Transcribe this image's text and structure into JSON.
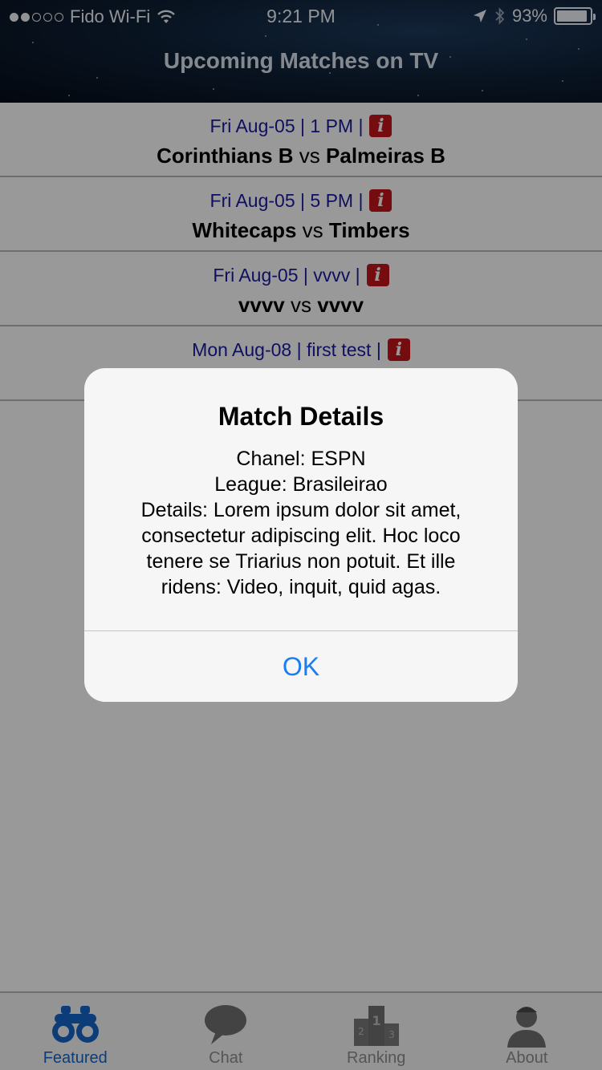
{
  "status_bar": {
    "carrier": "Fido Wi-Fi",
    "time": "9:21 PM",
    "battery": "93%",
    "battery_level": 0.93,
    "signal_bars_filled": 2,
    "signal_bars_total": 5,
    "icons": [
      "wifi-icon",
      "location-arrow-icon",
      "bluetooth-icon",
      "battery-icon"
    ]
  },
  "header": {
    "title": "Upcoming Matches on TV"
  },
  "matches": [
    {
      "meta": "Fri Aug-05 | 1 PM |",
      "home": "Corinthians B",
      "vs": "vs",
      "away": "Palmeiras B"
    },
    {
      "meta": "Fri Aug-05 | 5 PM |",
      "home": "Whitecaps",
      "vs": "vs",
      "away": "Timbers"
    },
    {
      "meta": "Fri Aug-05 | vvvv |",
      "home": "vvvv",
      "vs": "vs",
      "away": "vvvv"
    },
    {
      "meta": "Mon Aug-08 | first test |",
      "home": "",
      "vs": "",
      "away": ""
    }
  ],
  "info_icon_glyph": "i",
  "alert": {
    "title": "Match Details",
    "lines": [
      "Chanel: ESPN",
      "League: Brasileirao",
      " Details: Lorem ipsum dolor sit amet,",
      "consectetur adipiscing elit. Hoc loco",
      "tenere se Triarius non potuit. Et ille",
      "ridens: Video, inquit, quid agas."
    ],
    "ok_label": "OK"
  },
  "tabs": [
    {
      "label": "Featured",
      "icon": "binoculars-icon",
      "active": true
    },
    {
      "label": "Chat",
      "icon": "chat-bubble-icon",
      "active": false
    },
    {
      "label": "Ranking",
      "icon": "podium-icon",
      "active": false
    },
    {
      "label": "About",
      "icon": "user-icon",
      "active": false
    }
  ],
  "colors": {
    "meta_text": "#1a1aa0",
    "info_badge": "#c4161c",
    "tab_active": "#1566c9",
    "tab_inactive": "#8e8e93",
    "alert_button": "#1a7ef0"
  }
}
